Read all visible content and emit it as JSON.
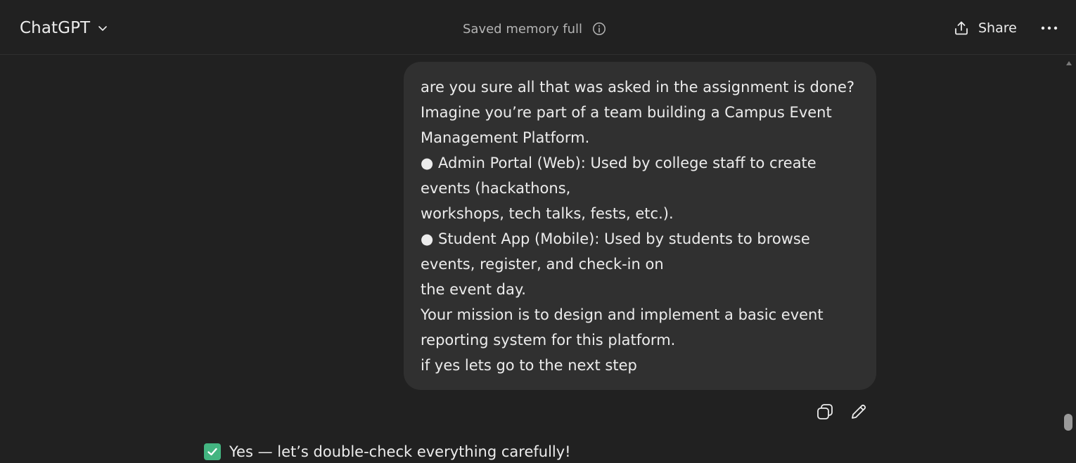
{
  "header": {
    "model_name": "ChatGPT",
    "memory_status": "Saved memory full",
    "share_label": "Share"
  },
  "conversation": {
    "user_message": {
      "lines": [
        "are you sure all that was asked in the assignment is done?",
        "Imagine you’re part of a team building a Campus Event",
        "Management Platform.",
        "● Admin Portal (Web): Used by college staff to create",
        "events (hackathons,",
        "workshops, tech talks, fests, etc.).",
        "● Student App (Mobile): Used by students to browse",
        "events, register, and check-in on",
        "the event day.",
        "Your mission is to design and implement a basic event",
        "reporting system for this platform.",
        "if yes lets go to the next step"
      ]
    },
    "assistant_reply": {
      "icon": "white-check-mark-icon",
      "text": "Yes — let’s double-check everything carefully!"
    }
  },
  "icons": {
    "model_chevron": "chevron-down-icon",
    "memory_info": "info-icon",
    "share": "share-upload-icon",
    "more": "more-horizontal-icon",
    "copy": "copy-icon",
    "edit": "pencil-icon"
  },
  "colors": {
    "background": "#212121",
    "bubble": "#303030",
    "text": "#ececec",
    "muted_text": "#b4b4b4",
    "check_green": "#43b581"
  }
}
